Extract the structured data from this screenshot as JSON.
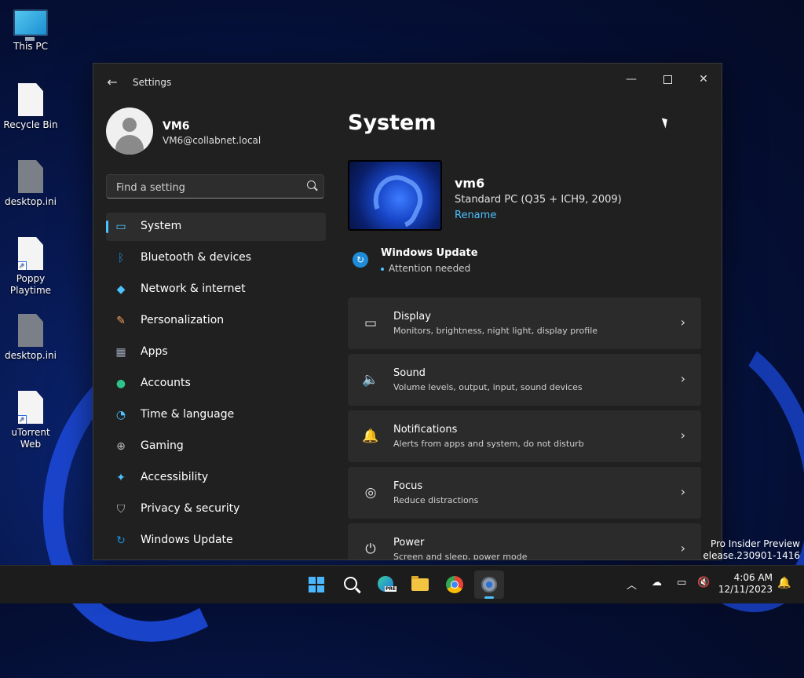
{
  "desktop": {
    "icons": [
      {
        "label": "This PC"
      },
      {
        "label": "Recycle Bin"
      },
      {
        "label": "desktop.ini"
      },
      {
        "label": "Poppy Playtime"
      },
      {
        "label": "desktop.ini"
      },
      {
        "label": "uTorrent Web"
      }
    ],
    "watermark_line1": "Pro Insider Preview",
    "watermark_line2": "elease.230901-1416"
  },
  "window": {
    "title": "Settings",
    "back_glyph": "←",
    "minimize_glyph": "—",
    "close_glyph": "✕"
  },
  "profile": {
    "name": "VM6",
    "email": "VM6@collabnet.local"
  },
  "search": {
    "placeholder": "Find a setting"
  },
  "nav": {
    "items": [
      {
        "label": "System",
        "icon": "▭",
        "color": "#4cc2ff"
      },
      {
        "label": "Bluetooth & devices",
        "icon": "ᛒ",
        "color": "#1e8cd8"
      },
      {
        "label": "Network & internet",
        "icon": "◆",
        "color": "#4cc2ff"
      },
      {
        "label": "Personalization",
        "icon": "✎",
        "color": "#f0a35e"
      },
      {
        "label": "Apps",
        "icon": "▦",
        "color": "#9aa3b5"
      },
      {
        "label": "Accounts",
        "icon": "●",
        "color": "#2fc28a"
      },
      {
        "label": "Time & language",
        "icon": "◔",
        "color": "#4cc2ff"
      },
      {
        "label": "Gaming",
        "icon": "⊕",
        "color": "#bdbdbd"
      },
      {
        "label": "Accessibility",
        "icon": "✦",
        "color": "#4cc2ff"
      },
      {
        "label": "Privacy & security",
        "icon": "⛉",
        "color": "#bdbdbd"
      },
      {
        "label": "Windows Update",
        "icon": "↻",
        "color": "#1e8cd8"
      }
    ]
  },
  "main": {
    "title": "System",
    "device": {
      "name": "vm6",
      "model": "Standard PC (Q35 + ICH9, 2009)",
      "rename_label": "Rename"
    },
    "windows_update": {
      "title": "Windows Update",
      "status": "Attention needed"
    },
    "cards": [
      {
        "title": "Display",
        "subtitle": "Monitors, brightness, night light, display profile",
        "icon": "▭"
      },
      {
        "title": "Sound",
        "subtitle": "Volume levels, output, input, sound devices",
        "icon": "🔈"
      },
      {
        "title": "Notifications",
        "subtitle": "Alerts from apps and system, do not disturb",
        "icon": "🔔"
      },
      {
        "title": "Focus",
        "subtitle": "Reduce distractions",
        "icon": "◎"
      },
      {
        "title": "Power",
        "subtitle": "Screen and sleep, power mode",
        "icon": "⏻"
      }
    ],
    "chevron": "›"
  },
  "taskbar": {
    "tray_chevron": "︿",
    "time": "4:06 AM",
    "date": "12/11/2023",
    "edge_badge": "PRE"
  },
  "colors": {
    "accent": "#4cc2ff",
    "window_bg": "#202020",
    "card_bg": "#2b2b2b"
  }
}
